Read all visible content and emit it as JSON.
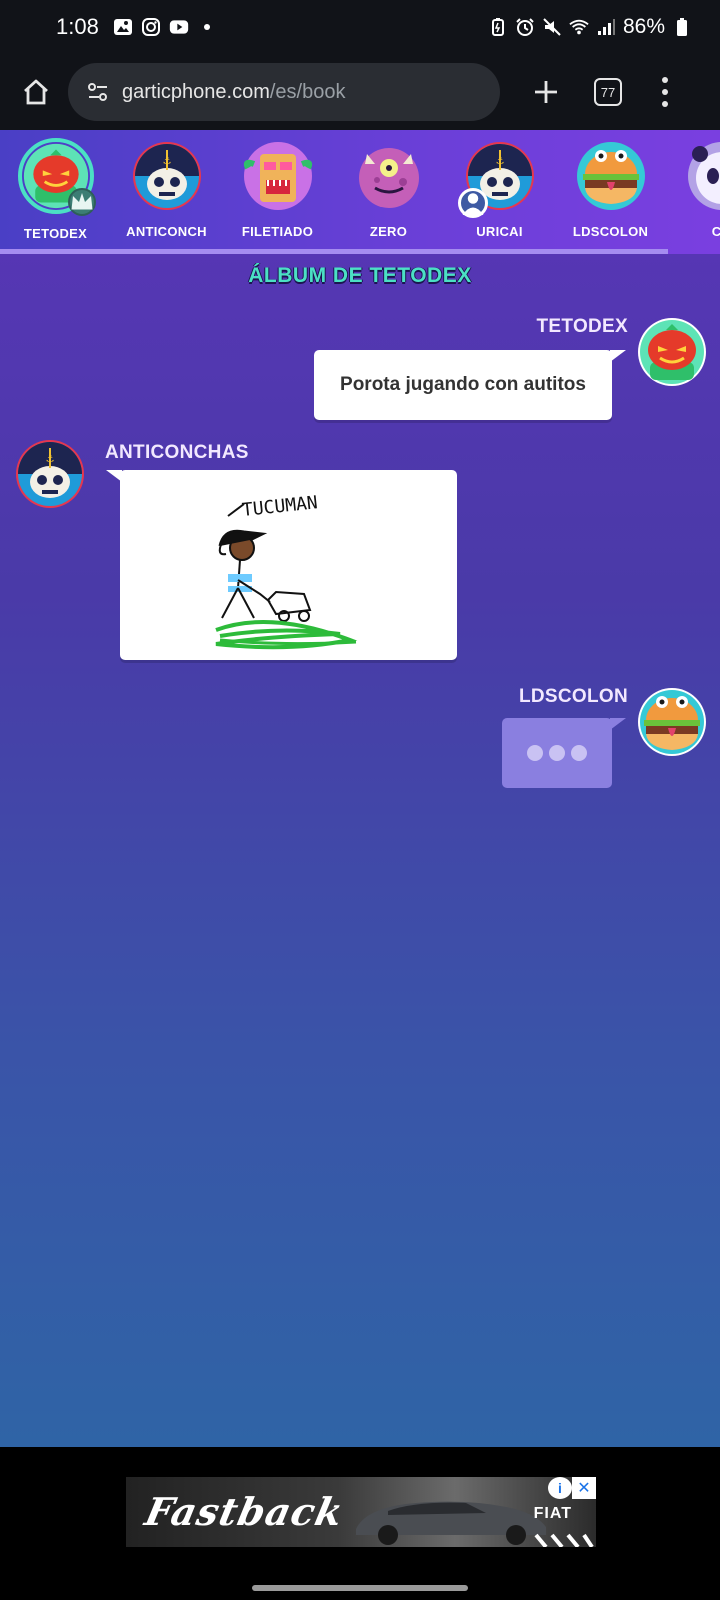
{
  "status_bar": {
    "time": "1:08",
    "battery": "86%"
  },
  "browser": {
    "url_host": "garticphone.com",
    "url_path": "/es/book",
    "tab_count": "77"
  },
  "players": [
    {
      "name": "TETODEX",
      "avatar": "tomato-avatar",
      "selected": true,
      "badge": "crown"
    },
    {
      "name": "ANTICONCH",
      "avatar": "skull-captain-avatar"
    },
    {
      "name": "FILETIADO",
      "avatar": "tiki-avatar"
    },
    {
      "name": "ZERO",
      "avatar": "pink-monster-avatar"
    },
    {
      "name": "URICAI",
      "avatar": "skull-captain-avatar",
      "badge": "user"
    },
    {
      "name": "LDSCOLON",
      "avatar": "burger-avatar"
    },
    {
      "name": "CA",
      "avatar": "panda-avatar"
    }
  ],
  "album_title": "ÁLBUM DE TETODEX",
  "messages": [
    {
      "author": "TETODEX",
      "text": "Porota jugando con autitos",
      "side": "right"
    },
    {
      "author": "ANTICONCHAS",
      "type": "drawing",
      "drawing_text": "TUCUMAN",
      "side": "left"
    },
    {
      "author": "LDSCOLON",
      "type": "pending",
      "side": "right"
    }
  ],
  "ad": {
    "brand": "Fastback",
    "logo": "FIAT",
    "info": "i",
    "close": "✕"
  },
  "colors": {
    "accent_teal": "#4be0c4",
    "bar_purple": "#5a3fd0",
    "pending_bubble": "#8a7fe0"
  }
}
